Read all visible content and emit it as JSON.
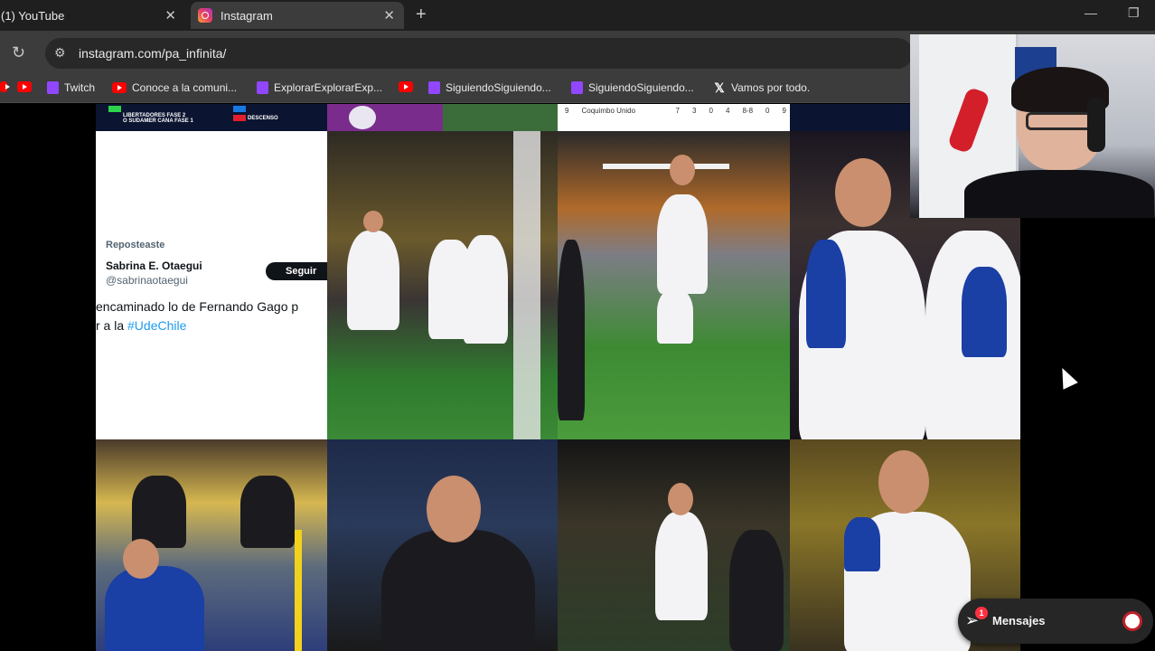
{
  "tabs": [
    {
      "title": "(1) YouTube",
      "active": false
    },
    {
      "title": "Instagram",
      "active": true
    }
  ],
  "toolbar": {
    "url": "instagram.com/pa_infinita/"
  },
  "bookmarks": [
    {
      "label": "",
      "icon": "youtube-icon"
    },
    {
      "label": "Twitch",
      "icon": "twitch-icon"
    },
    {
      "label": "Conoce a la comuni...",
      "icon": "youtube-icon"
    },
    {
      "label": "ExplorarExplorarExp...",
      "icon": "twitch-icon"
    },
    {
      "label": "",
      "icon": "youtube-icon"
    },
    {
      "label": "SiguiendoSiguiendo...",
      "icon": "twitch-icon"
    },
    {
      "label": "SiguiendoSiguiendo...",
      "icon": "twitch-icon"
    },
    {
      "label": "Vamos por todo.",
      "icon": "x-icon"
    }
  ],
  "strip": {
    "left_line1": "LIBERTADORES FASE 2",
    "left_line2": "O SUDAMER CANA FASE 1",
    "left_line3": "DESCENSO",
    "table_row": [
      "9",
      "Coquimbo Unido",
      "7",
      "3",
      "0",
      "4",
      "8-8",
      "0",
      "9"
    ]
  },
  "tweet": {
    "repost_label": "Reposteaste",
    "name": "Sabrina E. Otaegui",
    "handle": "@sabrinaotaegui",
    "follow_label": "Seguir",
    "line1": "encaminado lo de Fernando Gago p",
    "line2_prefix": "r a la ",
    "hashtag": "#UdeChile"
  },
  "messages": {
    "label": "Mensajes",
    "badge_count": "1"
  },
  "colors": {
    "ig_badge": "#ff3040",
    "hashtag": "#1d9bf0",
    "udechile_blue": "#1a3fa5"
  }
}
